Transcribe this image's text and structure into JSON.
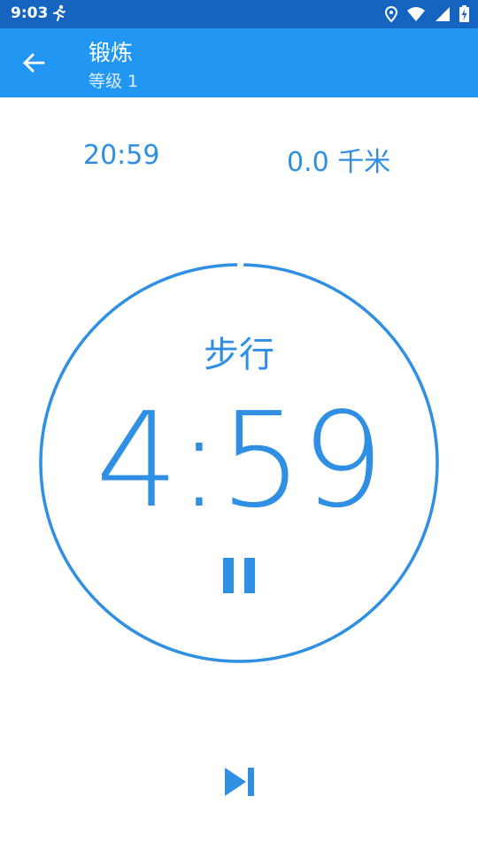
{
  "status_bar": {
    "time": "9:03",
    "icons": [
      "running-man-icon",
      "location-icon",
      "wifi-icon",
      "signal-icon",
      "battery-charging-icon"
    ]
  },
  "app_bar": {
    "back_icon": "arrow-left-icon",
    "title": "锻炼",
    "subtitle": "等级 1"
  },
  "stats": {
    "total_time": "20:59",
    "distance": "0.0 千米"
  },
  "workout": {
    "activity": "步行",
    "countdown": "4:59",
    "progress_fraction": 0.003,
    "pause_icon": "pause-icon",
    "skip_icon": "skip-next-icon"
  },
  "colors": {
    "status_bar": "#1565c0",
    "app_bar": "#2196f3",
    "accent": "#2f8fe3",
    "background": "#ffffff"
  }
}
